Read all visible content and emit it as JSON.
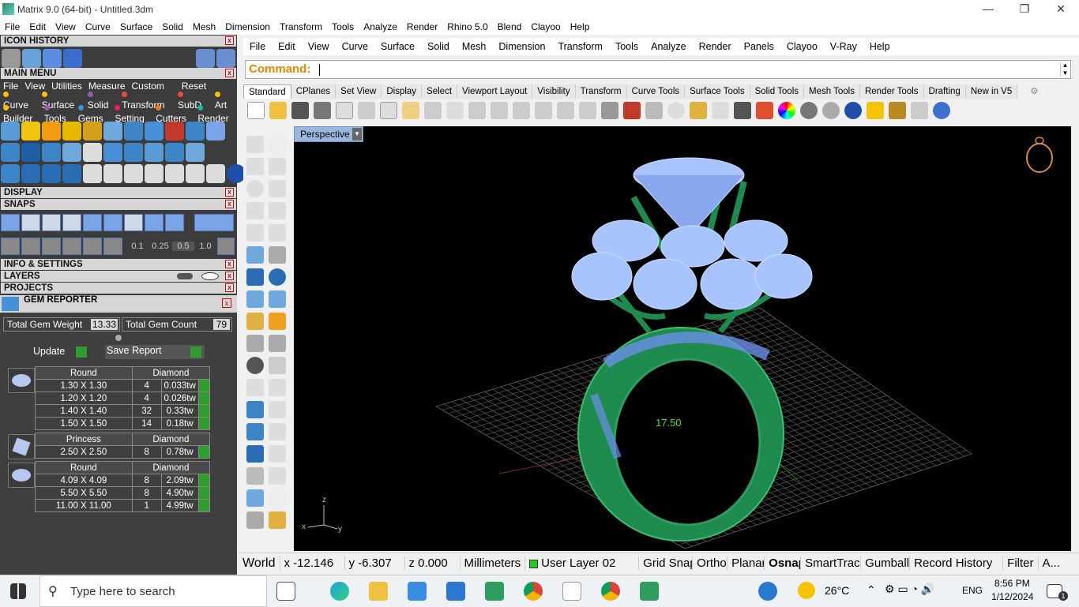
{
  "window": {
    "title": "Matrix 9.0 (64-bit) - Untitled.3dm"
  },
  "menubar": [
    "File",
    "Edit",
    "View",
    "Curve",
    "Surface",
    "Solid",
    "Mesh",
    "Dimension",
    "Transform",
    "Tools",
    "Analyze",
    "Render",
    "Rhino 5.0",
    "Blend",
    "Clayoo",
    "Help"
  ],
  "left_panel": {
    "icon_history": "ICON HISTORY",
    "main_menu": "MAIN MENU",
    "main_menu_items": [
      "File",
      "View",
      "Utilities",
      "Measure",
      "Custom"
    ],
    "reset": "Reset",
    "categories_row1": [
      "Curve",
      "Surface",
      "Solid",
      "Transform",
      "SubD",
      "Art"
    ],
    "categories_row2": [
      "Builder",
      "Tools",
      "Gems",
      "Setting",
      "Cutters",
      "Render"
    ],
    "display": "DISPLAY",
    "snaps": "SNAPS",
    "snap_values": [
      "0.1",
      "0.25",
      "0.5",
      "1.0"
    ],
    "info_settings": "INFO & SETTINGS",
    "layers": "LAYERS",
    "projects": "PROJECTS",
    "gem_reporter": "GEM REPORTER",
    "total_gem_weight_label": "Total Gem Weight",
    "total_gem_weight": "13.33",
    "total_gem_count_label": "Total Gem Count",
    "total_gem_count": "79",
    "update": "Update",
    "save_report": "Save Report",
    "gem_groups": [
      {
        "shape": "Round",
        "material": "Diamond",
        "rows": [
          [
            "1.30 X 1.30",
            "4",
            "0.033tw"
          ],
          [
            "1.20 X 1.20",
            "4",
            "0.026tw"
          ],
          [
            "1.40 X 1.40",
            "32",
            "0.33tw"
          ],
          [
            "1.50 X 1.50",
            "14",
            "0.18tw"
          ]
        ]
      },
      {
        "shape": "Princess",
        "material": "Diamond",
        "rows": [
          [
            "2.50 X 2.50",
            "8",
            "0.78tw"
          ]
        ]
      },
      {
        "shape": "Round",
        "material": "Diamond",
        "rows": [
          [
            "4.09 X 4.09",
            "8",
            "2.09tw"
          ],
          [
            "5.50 X 5.50",
            "8",
            "4.90tw"
          ],
          [
            "11.00 X 11.00",
            "1",
            "4.99tw"
          ]
        ]
      }
    ]
  },
  "rhino_menubar": [
    "File",
    "Edit",
    "View",
    "Curve",
    "Surface",
    "Solid",
    "Mesh",
    "Dimension",
    "Transform",
    "Tools",
    "Analyze",
    "Render",
    "Panels",
    "Clayoo",
    "V-Ray",
    "Help"
  ],
  "command_label": "Command:",
  "tabs": [
    "Standard",
    "CPlanes",
    "Set View",
    "Display",
    "Select",
    "Viewport Layout",
    "Visibility",
    "Transform",
    "Curve Tools",
    "Surface Tools",
    "Solid Tools",
    "Mesh Tools",
    "Render Tools",
    "Drafting",
    "New in V5"
  ],
  "viewport": {
    "name": "Perspective",
    "dimension": "17.50",
    "axis_z": "z",
    "axis_x": "x",
    "axis_y": "y"
  },
  "status": {
    "world": "World",
    "x": "x -12.146",
    "y": "y -6.307",
    "z": "z 0.000",
    "units": "Millimeters",
    "layer": "User Layer 02",
    "grid": "Grid Snap",
    "ortho": "Ortho",
    "planar": "Planar",
    "osnap": "Osnap",
    "smarttrack": "SmartTrack",
    "gumball": "Gumball",
    "record": "Record History",
    "filter": "Filter",
    "more": "A..."
  },
  "taskbar": {
    "search_placeholder": "Type here to search",
    "temperature": "26°C",
    "language": "ENG",
    "time": "8:56 PM",
    "date": "1/12/2024",
    "notifications": "1"
  },
  "colors": {
    "accent": "#7aa4e8",
    "ring": "#1e8a4e",
    "gems": "#a8c4ff",
    "command": "#e08a00"
  }
}
